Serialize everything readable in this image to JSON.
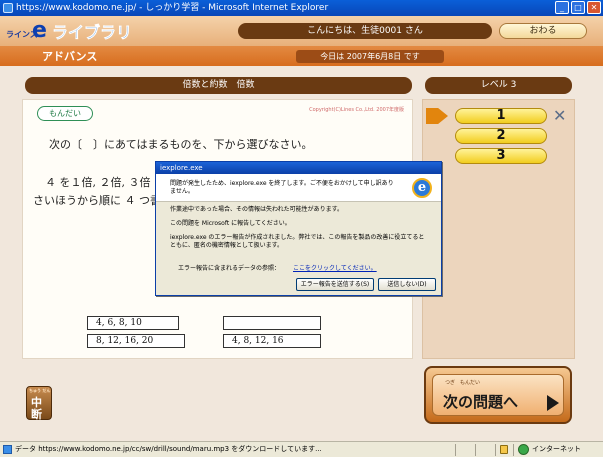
{
  "window": {
    "title": "https://www.kodomo.ne.jp/ - しっかり学習 - Microsoft Internet Explorer",
    "icons": [
      "ie-app-icon",
      "minimize-icon",
      "maximize-icon",
      "close-icon"
    ]
  },
  "header": {
    "logo_prefix": "ラインズ",
    "logo_e": "e",
    "logo_text": "ライブラリ",
    "greeting": "こんにちは、生徒0001 さん",
    "exit_label": "おわる",
    "mode": "アドバンス",
    "date": "今日は 2007年6月8日 です"
  },
  "main": {
    "topic": "倍数と約数　倍数",
    "level_title": "レベル 3",
    "mondai_label": "もんだい",
    "copyright": "Copyright(C)Lines Co.,Ltd. 2007年度版",
    "question": "次の〔　〕にあてはまるものを、下から選びなさい。",
    "line2": "４ を１倍, ２倍, ３倍",
    "line3": "さいほうから順に ４ つ書",
    "choices": [
      "4,  6,  8,  10",
      "8,  12,  16,  20",
      "4,  8,  12,  16"
    ]
  },
  "levels": [
    "1",
    "2",
    "3"
  ],
  "buttons": {
    "chudan_ruby": "ちゅう だん",
    "chudan_label": "中断",
    "next_ruby": "つぎ　もんだい",
    "next_label": "次の問題へ"
  },
  "dialog": {
    "title": "iexplore.exe",
    "header": "問題が発生したため、iexplore.exe を終了します。ご不便をおかけして申し訳ありません。",
    "body1": "作業途中であった場合、その情報は失われた可能性があります。",
    "body2": "この問題を Microsoft に報告してください。",
    "body3": "iexplore.exe のエラー報告が作成されました。弊社では、この報告を製品の改善に役立てるとともに、匿名の機密情報として扱います。",
    "ref_label": "エラー報告に含まれるデータの参照：",
    "link_label": "ここをクリックしてください。",
    "send_label": "エラー報告を送信する(S)",
    "nosend_label": "送信しない(D)"
  },
  "status": {
    "text": "データ https://www.kodomo.ne.jp/cc/sw/drill/sound/maru.mp3 をダウンロードしています...",
    "zone": "インターネット"
  }
}
